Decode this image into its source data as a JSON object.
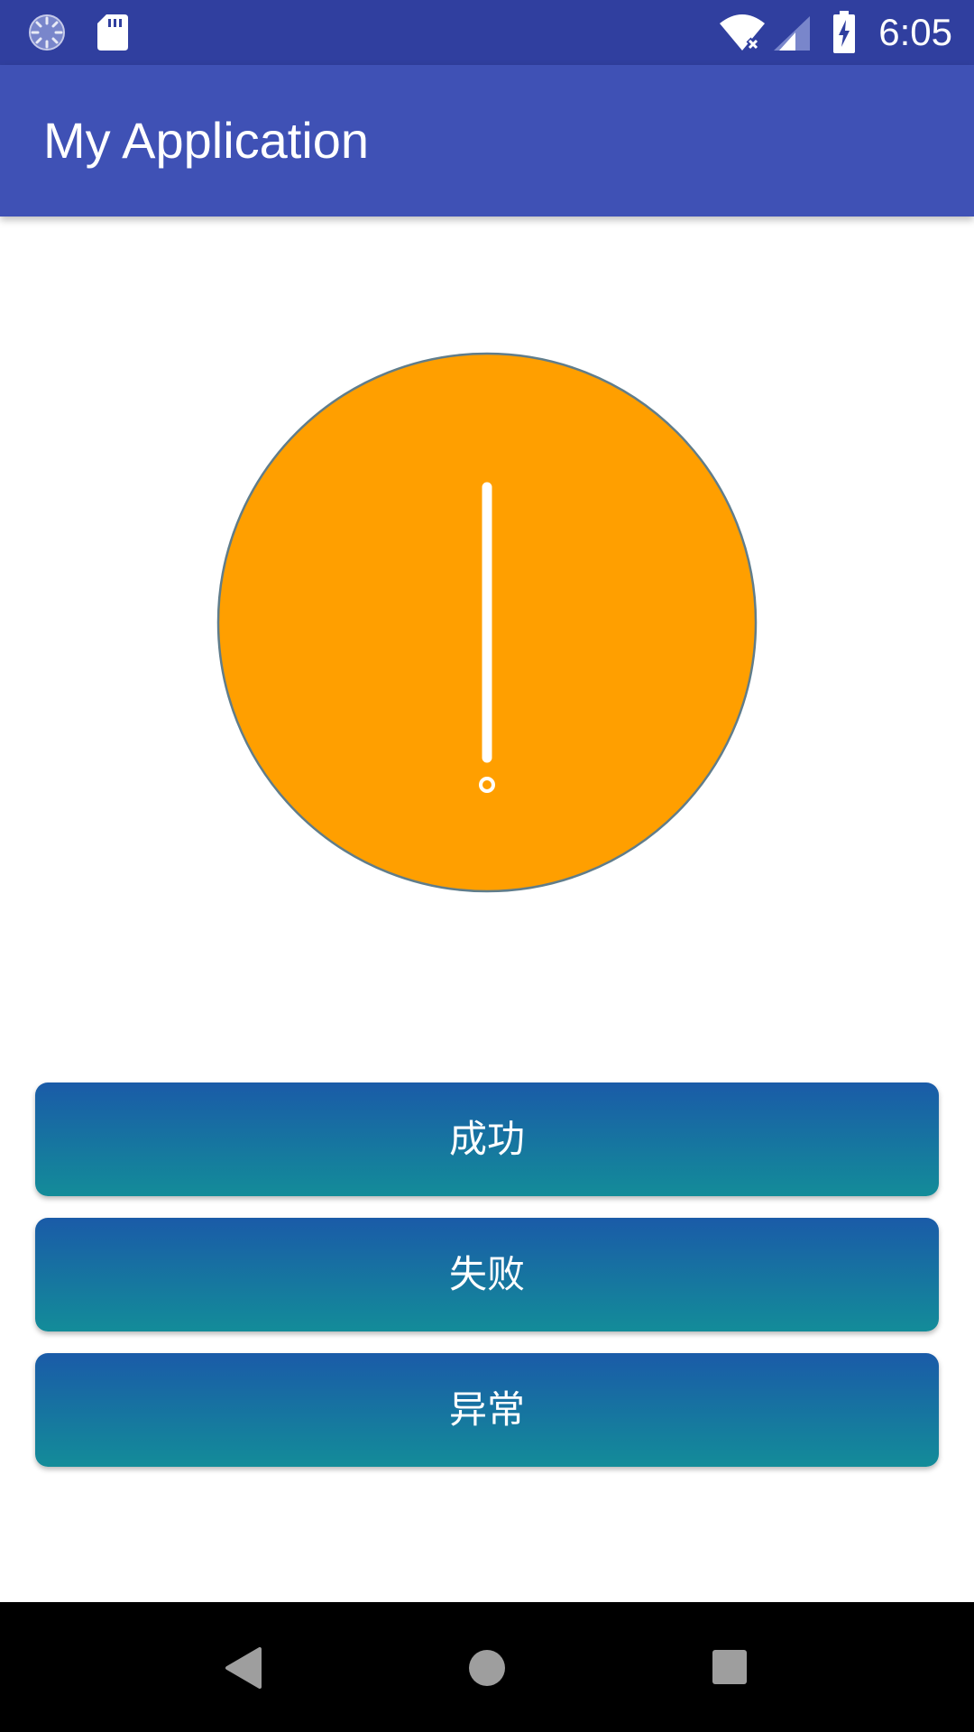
{
  "status_bar": {
    "time": "6:05",
    "icons": [
      "loading-icon",
      "sd-card-icon",
      "wifi-off-icon",
      "cell-signal-icon",
      "battery-charging-icon"
    ]
  },
  "app_bar": {
    "title": "My Application"
  },
  "indicator": {
    "state_icon": "exclamation-icon",
    "fill_color": "#FF9F00",
    "stroke_color": "#607D8B"
  },
  "buttons": {
    "success": "成功",
    "failure": "失败",
    "error": "异常"
  },
  "nav_bar": {
    "icons": [
      "back-icon",
      "home-icon",
      "recents-icon"
    ]
  },
  "colors": {
    "status_bar": "#303F9F",
    "app_bar": "#3F51B5",
    "button_top": "#1A5BA8",
    "button_bottom": "#138C99"
  }
}
